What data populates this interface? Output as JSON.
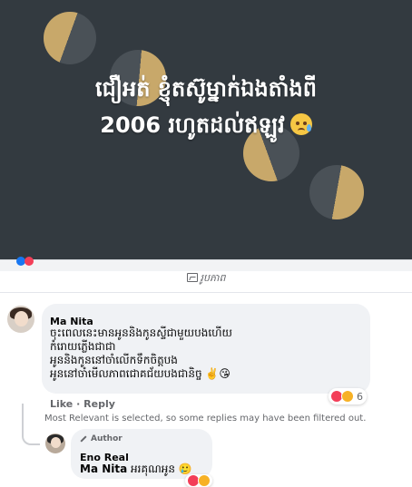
{
  "post": {
    "image_text_line1": "ជឿអត់ ខ្ញុំតស៊ូម្នាក់ឯងតាំងពី",
    "image_text_line2": "2006 រហូតដល់ឥឡូវ",
    "image_emoji": "crying-smile-emoji",
    "caption": "រូបភាព",
    "caption_icon": "image-icon"
  },
  "comments": [
    {
      "author": "Ma Nita",
      "lines": [
        "ចុះពេលនេះមានអូននិងកូនស្ទីជាមួយបងហើយ",
        "កំរោយភ្លើងជាជា",
        "អូននិងកូននៅចាំលើកទឹកចិត្តបង",
        "អូននៅចាំមើលភាពជោគជ័យបងជានិច្ច"
      ],
      "line4_emojis": "✌️😘",
      "reactions": {
        "icons": [
          "heart",
          "haha"
        ],
        "count": "6"
      },
      "actions": {
        "like": "Like",
        "separator": "·",
        "reply": "Reply"
      }
    }
  ],
  "filter_note": "Most Relevant is selected, so some replies may have been filtered out.",
  "reply": {
    "badge": "Author",
    "author": "Eno Real",
    "mention": "Ma Nita",
    "text": "អរគុណអូន",
    "emoji": "🥲"
  },
  "colors": {
    "image_bg": "#333a40",
    "moon_gold": "#c8a86a",
    "bubble_bg": "#f0f2f5",
    "meta_text": "#65676b"
  }
}
